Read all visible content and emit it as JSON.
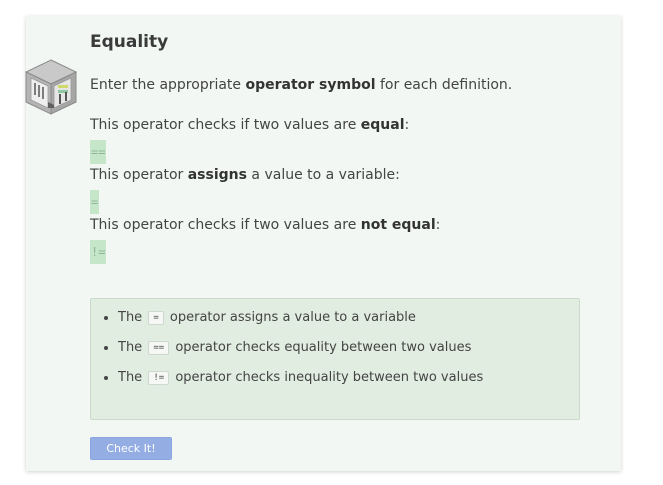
{
  "exercise": {
    "title": "Equality",
    "instruction": {
      "pre": "Enter the appropriate ",
      "bold": "operator symbol",
      "post": " for each definition."
    },
    "questions": [
      {
        "pre": "This operator checks if two values are ",
        "bold": "equal",
        "post": ":",
        "answer": "=="
      },
      {
        "pre": "This operator ",
        "bold": "assigns",
        "post": " a value to a variable:",
        "answer": "="
      },
      {
        "pre": "This operator checks if two values are ",
        "bold": "not equal",
        "post": ":",
        "answer": "!="
      }
    ]
  },
  "hint": {
    "items": [
      {
        "pre": "The",
        "code": "=",
        "post": "operator assigns a value to a variable"
      },
      {
        "pre": "The",
        "code": "==",
        "post": "operator checks equality between two values"
      },
      {
        "pre": "The",
        "code": "!=",
        "post": "operator checks inequality between two values"
      }
    ]
  },
  "check_button": {
    "label": "Check It!"
  },
  "icons": {
    "avatar": "isometric-room-icon"
  },
  "colors": {
    "card_bg": "#f2f7f3",
    "answer_bg": "#c5e6c8",
    "hint_bg": "#e0ede0",
    "button_bg": "#94aee4"
  }
}
